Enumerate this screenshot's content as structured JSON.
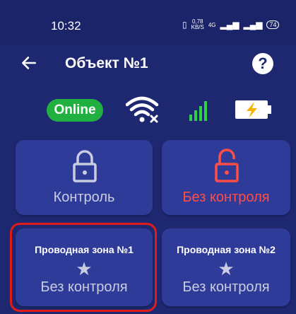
{
  "status_bar": {
    "time": "10:32",
    "speed_value": "0,78",
    "speed_unit": "KB/S",
    "network": "4G",
    "battery_level": "74"
  },
  "appbar": {
    "title": "Объект №1",
    "help": "?"
  },
  "indicators": {
    "online_label": "Online",
    "wifi_icon": "wifi-disconnected-icon",
    "signal_icon": "cellular-signal-icon",
    "battery_icon": "battery-charging-icon",
    "colors": {
      "online": "#20b040",
      "signal": "#2fd04a",
      "battery_bolt": "#f5b300"
    }
  },
  "cards": [
    {
      "label": "Контроль",
      "icon": "lock-closed-icon",
      "color": "#c9cde2"
    },
    {
      "label": "Без контроля",
      "icon": "lock-open-icon",
      "color": "#ff4e45"
    }
  ],
  "zones": [
    {
      "name": "Проводная зона №1",
      "state": "Без контроля",
      "icon": "star-icon",
      "selected": true
    },
    {
      "name": "Проводная зона №2",
      "state": "Без контроля",
      "icon": "star-icon",
      "selected": false
    }
  ],
  "colors": {
    "background": "#1e2870",
    "card": "#2f3b99",
    "selection": "#e11a1a"
  }
}
